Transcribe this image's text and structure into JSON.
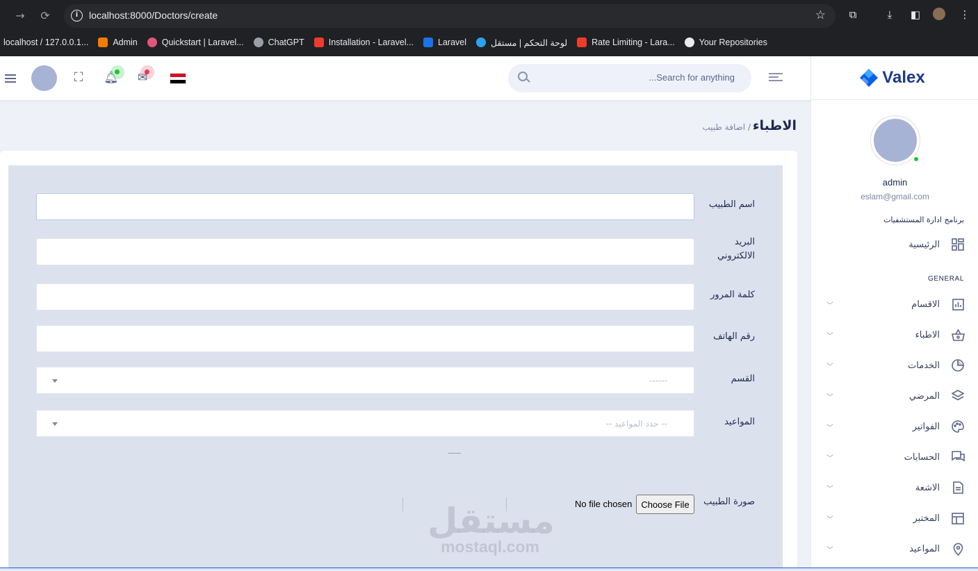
{
  "browser": {
    "url": "localhost:8000/Doctors/create",
    "bookmarks": [
      {
        "label": "localhost / 127.0.0.1...",
        "color": ""
      },
      {
        "label": "Admin",
        "color": "#f57c00"
      },
      {
        "label": "Quickstart | Laravel...",
        "color": "#e2557a"
      },
      {
        "label": "ChatGPT",
        "color": "#9aa0a6"
      },
      {
        "label": "Installation - Laravel...",
        "color": "#ef3b2d"
      },
      {
        "label": "Laravel",
        "color": "#1a73e8"
      },
      {
        "label": "لوحة التحكم | مستقل",
        "color": "#2aa3ef"
      },
      {
        "label": "Rate Limiting - Lara...",
        "color": "#ef3b2d"
      },
      {
        "label": "Your Repositories",
        "color": "#e8eaed"
      }
    ]
  },
  "sidebar": {
    "brand": "Valex",
    "profile_name": "admin",
    "profile_email": "eslam@gmail.com",
    "app_title": "برنامج ادارة المستشفيات",
    "home_label": "الرئيسية",
    "section_label": "GENERAL",
    "items": [
      {
        "label": "الاقسام",
        "icon": "bar-chart-icon"
      },
      {
        "label": "الاطباء",
        "icon": "basket-icon"
      },
      {
        "label": "الخدمات",
        "icon": "pie-chart-icon"
      },
      {
        "label": "المرضي",
        "icon": "layers-icon"
      },
      {
        "label": "الفواتير",
        "icon": "palette-icon"
      },
      {
        "label": "الحسابات",
        "icon": "chat-icon"
      },
      {
        "label": "الاشعة",
        "icon": "document-icon"
      },
      {
        "label": "المختبر",
        "icon": "table-icon"
      },
      {
        "label": "المواعيد",
        "icon": "location-pin-icon"
      }
    ]
  },
  "header": {
    "search_placeholder": "Search for anything..."
  },
  "page": {
    "title": "الاطباء",
    "breadcrumb": "/ اضافة طبيب"
  },
  "form": {
    "name_label": "اسم الطبيب",
    "email_label": "البريد الالكتروني",
    "password_label": "كلمة المرور",
    "phone_label": "رقم الهاتف",
    "section_label": "القسم",
    "section_placeholder": "------",
    "appointments_label": "المواعيد",
    "appointments_placeholder": "-- حدد المواعيد --",
    "photo_label": "صورة الطبيب",
    "file_button": "Choose File",
    "file_status": "No file chosen"
  },
  "watermark": {
    "ar": "مستقل",
    "en": "mostaql.com"
  }
}
